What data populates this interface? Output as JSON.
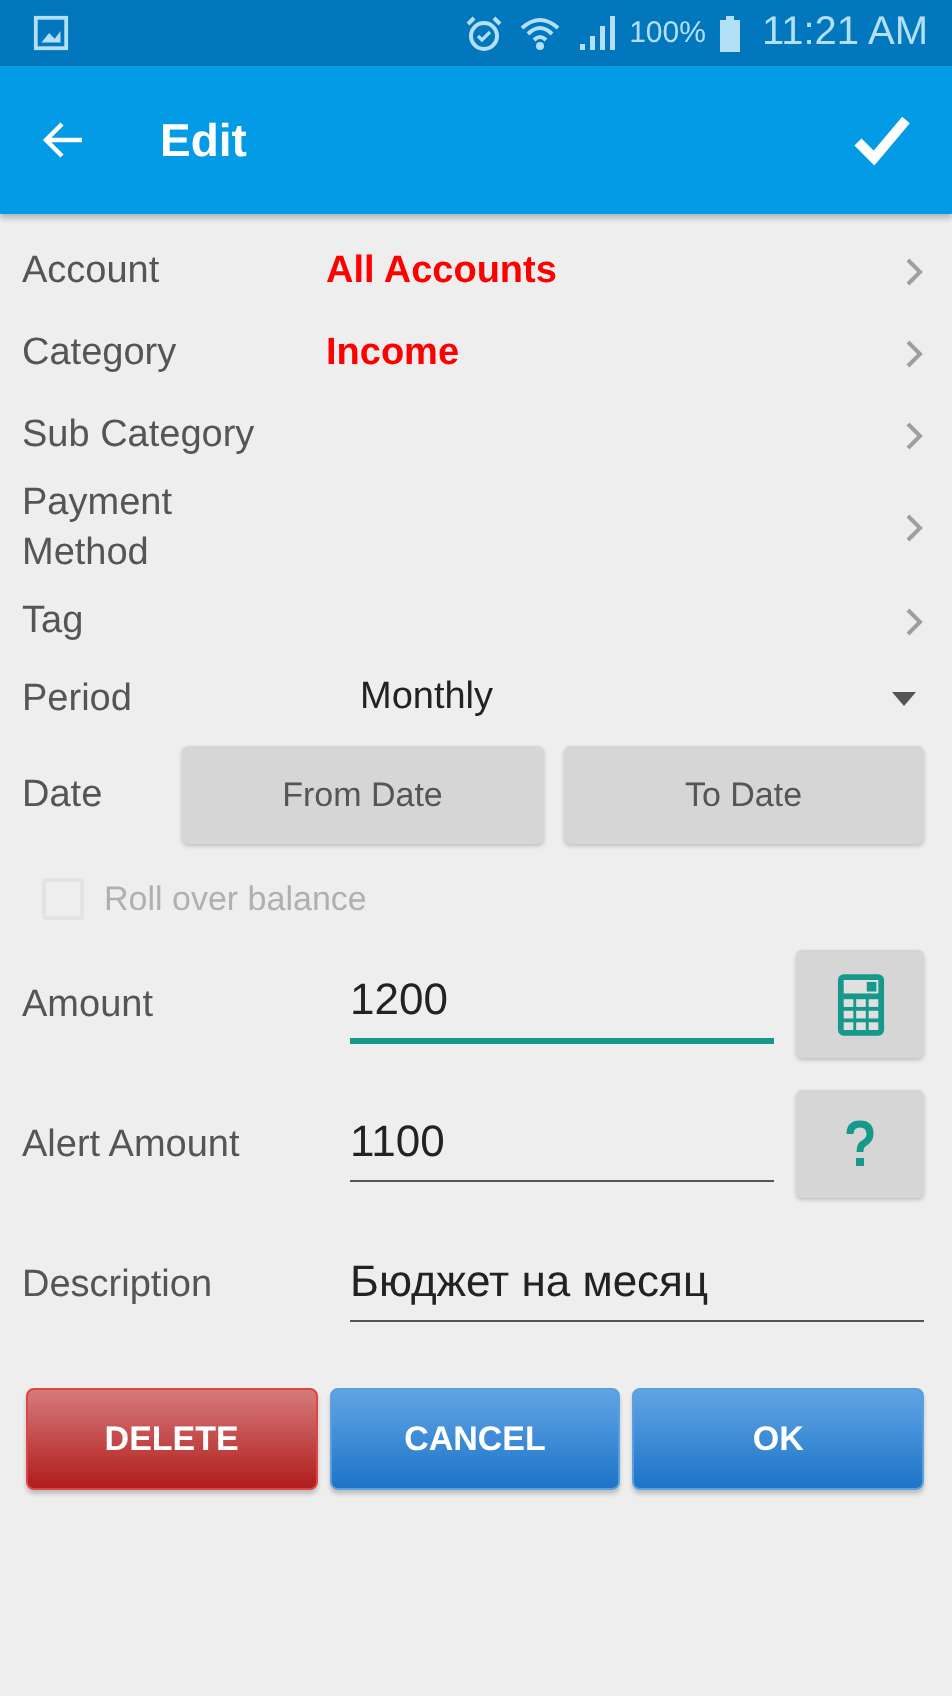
{
  "status_bar": {
    "battery": "100%",
    "time": "11:21 AM"
  },
  "app_bar": {
    "title": "Edit"
  },
  "nav_rows": [
    {
      "label": "Account",
      "value": "All Accounts"
    },
    {
      "label": "Category",
      "value": "Income"
    },
    {
      "label": "Sub Category"
    },
    {
      "label": "Payment Method"
    },
    {
      "label": "Tag"
    }
  ],
  "period": {
    "label": "Period",
    "value": "Monthly"
  },
  "date": {
    "label": "Date",
    "buttons": [
      "From Date",
      "To Date"
    ]
  },
  "roll_over": {
    "label": "Roll over balance",
    "checked": false,
    "disabled": true
  },
  "fields": [
    {
      "label": "Amount",
      "value": "1200",
      "focused": true,
      "kind": "calculator"
    },
    {
      "label": "Alert Amount",
      "value": "1100",
      "focused": false,
      "kind": "help"
    },
    {
      "label": "Description",
      "value": "Бюджет на месяц",
      "focused": false,
      "kind": "none"
    }
  ],
  "actions": [
    {
      "label": "DELETE",
      "kind": "danger"
    },
    {
      "label": "CANCEL",
      "kind": "primary"
    },
    {
      "label": "OK",
      "kind": "primary"
    }
  ]
}
